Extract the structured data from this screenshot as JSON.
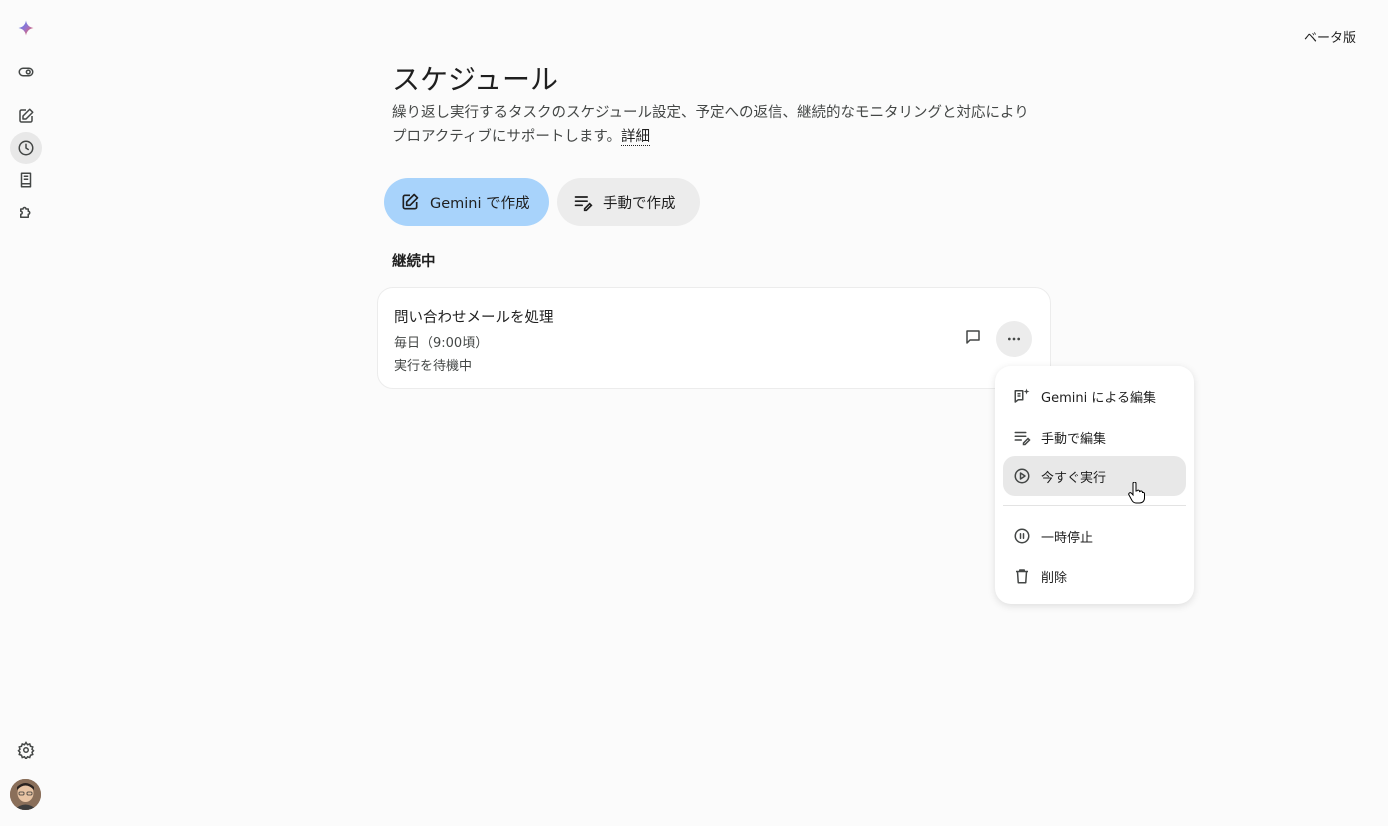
{
  "header": {
    "beta_label": "ベータ版"
  },
  "sidebar": {
    "items": [
      {
        "icon": "gemini-logo"
      },
      {
        "icon": "toggle-icon"
      },
      {
        "icon": "edit-icon"
      },
      {
        "icon": "clock-icon",
        "active": true
      },
      {
        "icon": "notes-icon"
      },
      {
        "icon": "puzzle-icon"
      },
      {
        "icon": "gear-icon"
      }
    ]
  },
  "main": {
    "title": "スケジュール",
    "description": "繰り返し実行するタスクのスケジュール設定、予定への返信、継続的なモニタリングと対応によりプロアクティブにサポートします。",
    "details_link": "詳細",
    "create_gemini_label": "Gemini で作成",
    "create_manual_label": "手動で作成",
    "section_label": "継続中"
  },
  "task": {
    "title": "問い合わせメールを処理",
    "schedule": "毎日（9:00頃）",
    "status": "実行を待機中"
  },
  "menu": {
    "items": [
      {
        "label": "Gemini による編集",
        "icon": "sparkle-edit-icon"
      },
      {
        "label": "手動で編集",
        "icon": "manual-edit-icon"
      },
      {
        "label": "今すぐ実行",
        "icon": "play-circle-icon",
        "hovered": true
      },
      {
        "label": "一時停止",
        "icon": "pause-circle-icon"
      },
      {
        "label": "削除",
        "icon": "trash-icon"
      }
    ]
  },
  "colors": {
    "background": "#fbfbfb",
    "primary_button": "#a8d3fb",
    "secondary_button": "#ececec"
  }
}
